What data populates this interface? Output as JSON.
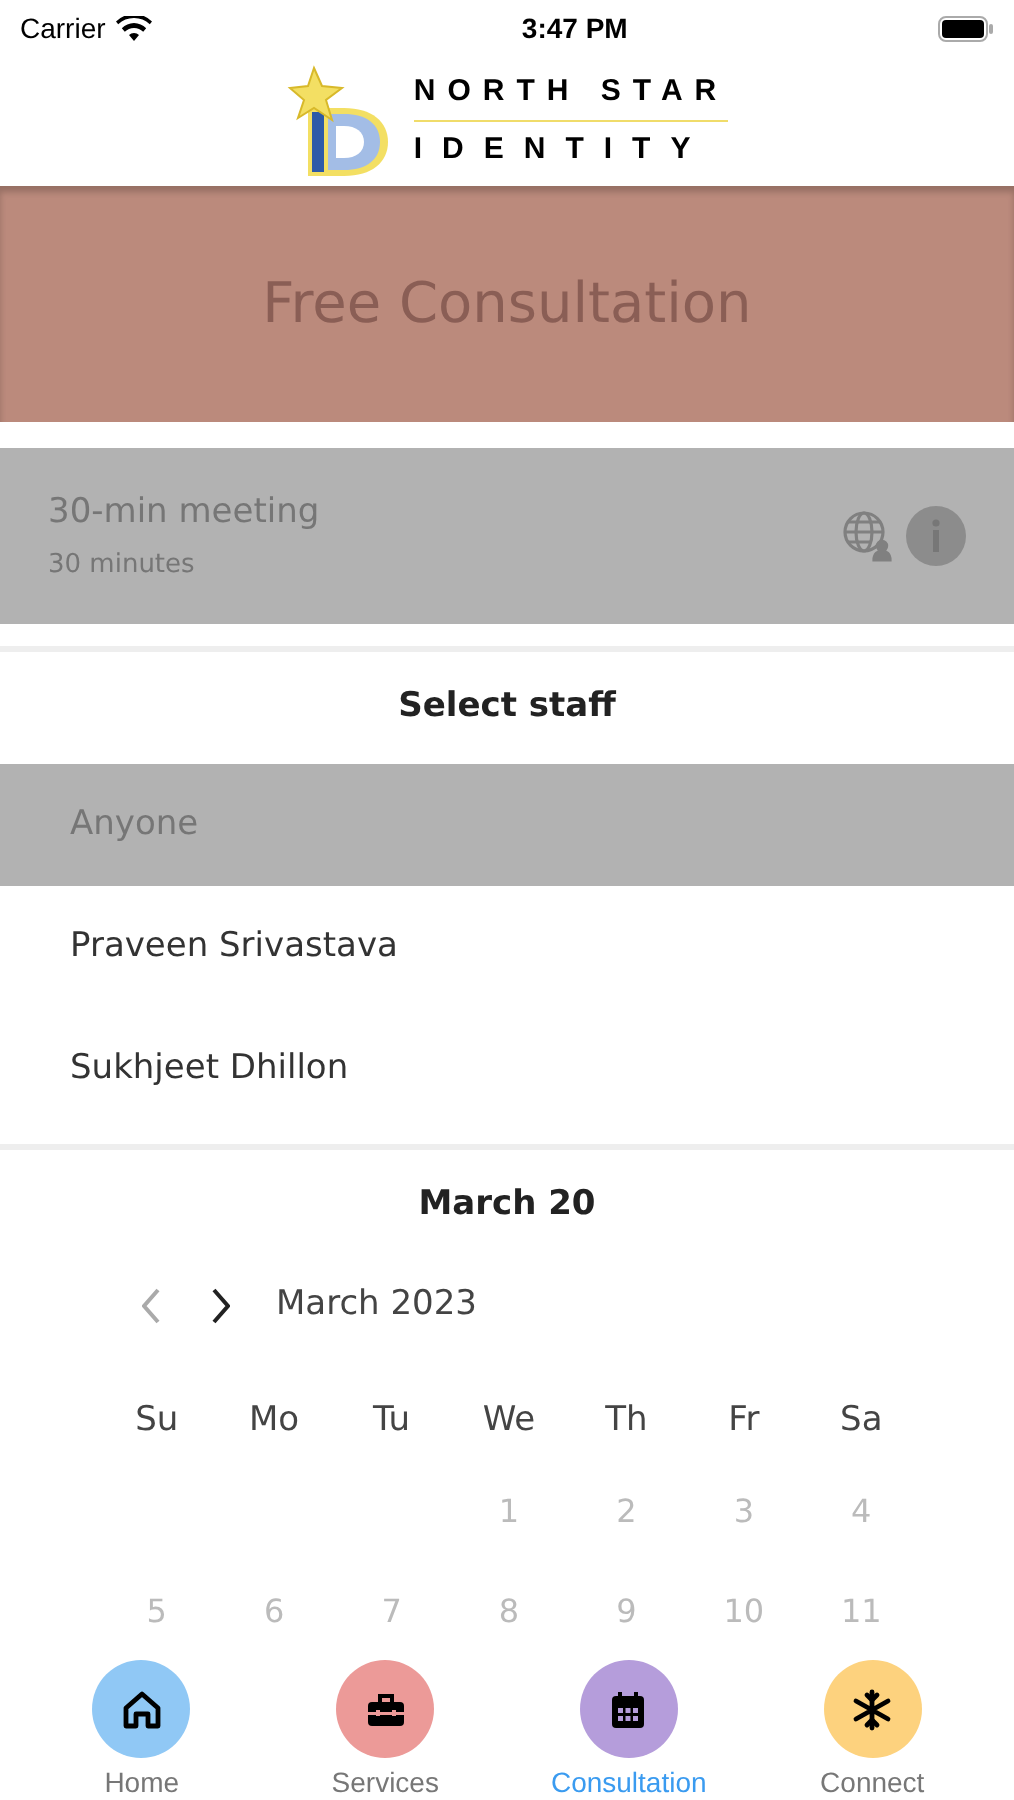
{
  "status_bar": {
    "carrier": "Carrier",
    "time": "3:47 PM"
  },
  "logo": {
    "line_1": "NORTH STAR",
    "line_2": "IDENTITY"
  },
  "banner": {
    "title": "Free Consultation"
  },
  "meeting": {
    "title": "30-min meeting",
    "duration": "30 minutes"
  },
  "staff": {
    "heading": "Select staff",
    "items": [
      {
        "name": "Anyone",
        "selected": true
      },
      {
        "name": "Praveen Srivastava",
        "selected": false
      },
      {
        "name": "Sukhjeet Dhillon",
        "selected": false
      }
    ]
  },
  "calendar": {
    "selected_date": "March 20",
    "month": "March 2023",
    "prev_disabled": true,
    "weekdays": [
      "Su",
      "Mo",
      "Tu",
      "We",
      "Th",
      "Fr",
      "Sa"
    ],
    "weeks": [
      {
        "right_aligned": true,
        "days": [
          {
            "day": "1",
            "disabled": true
          },
          {
            "day": "2",
            "disabled": true
          },
          {
            "day": "3",
            "disabled": true
          },
          {
            "day": "4",
            "disabled": true
          }
        ]
      },
      {
        "right_aligned": false,
        "days": [
          {
            "day": "5",
            "disabled": true
          },
          {
            "day": "6",
            "disabled": true
          },
          {
            "day": "7",
            "disabled": true
          },
          {
            "day": "8",
            "disabled": true
          },
          {
            "day": "9",
            "disabled": true
          },
          {
            "day": "10",
            "disabled": true
          },
          {
            "day": "11",
            "disabled": true
          }
        ]
      }
    ]
  },
  "tab_bar": [
    {
      "kind": "home",
      "label": "Home",
      "color": "#90c8f5",
      "selected": false
    },
    {
      "kind": "services",
      "label": "Services",
      "color": "#ec9a98",
      "selected": false
    },
    {
      "kind": "consultation",
      "label": "Consultation",
      "color": "#b59ddb",
      "selected": true
    },
    {
      "kind": "connect",
      "label": "Connect",
      "color": "#fdd27e",
      "selected": false
    }
  ]
}
